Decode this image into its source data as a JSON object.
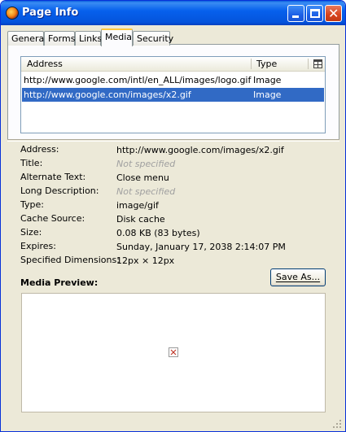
{
  "window": {
    "title": "Page Info",
    "icon": "firefox-icon"
  },
  "tabs": [
    {
      "label": "General"
    },
    {
      "label": "Forms"
    },
    {
      "label": "Links"
    },
    {
      "label": "Media",
      "active": true
    },
    {
      "label": "Security"
    }
  ],
  "media_list": {
    "columns": [
      "Address",
      "Type"
    ],
    "rows": [
      {
        "address": "http://www.google.com/intl/en_ALL/images/logo.gif",
        "type": "Image",
        "selected": false
      },
      {
        "address": "http://www.google.com/images/x2.gif",
        "type": "Image",
        "selected": true
      }
    ]
  },
  "details": [
    {
      "label": "Address:",
      "value": "http://www.google.com/images/x2.gif",
      "dim": false
    },
    {
      "label": "Title:",
      "value": "Not specified",
      "dim": true
    },
    {
      "label": "Alternate Text:",
      "value": "Close menu",
      "dim": false
    },
    {
      "label": "Long Description:",
      "value": "Not specified",
      "dim": true
    },
    {
      "label": "Type:",
      "value": "image/gif",
      "dim": false
    },
    {
      "label": "Cache Source:",
      "value": "Disk cache",
      "dim": false
    },
    {
      "label": "Size:",
      "value": "0.08 KB (83 bytes)",
      "dim": false
    },
    {
      "label": "Expires:",
      "value": "Sunday, January 17, 2038 2:14:07 PM",
      "dim": false
    },
    {
      "label": "Specified Dimensions:",
      "value": "12px × 12px",
      "dim": false
    }
  ],
  "save_button": {
    "label": "Save As..."
  },
  "media_preview": {
    "label": "Media Preview:"
  },
  "colors": {
    "selection": "#316ac5",
    "titlebar": "#0453dc",
    "dialog": "#ece9d8"
  }
}
